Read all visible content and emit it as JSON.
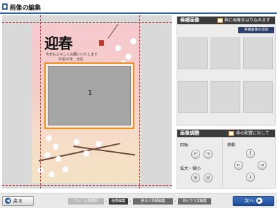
{
  "window": {
    "title": "画像の編集"
  },
  "card": {
    "logo_text": "迎春",
    "greeting_line1": "今年もよろしくお願いいたします",
    "greeting_line2": "平成28年　元旦",
    "photo_slot_number": "1"
  },
  "candidates": {
    "title": "候補画像",
    "checkbox_label": "枠に画像をはり込みます",
    "add_button": "候補画像の追加"
  },
  "adjust": {
    "title": "画像調整",
    "checkbox_label": "枠の配置に対して",
    "rotate_label": "回転",
    "zoom_label": "拡大・縮小",
    "move_label": "移動"
  },
  "footer": {
    "back_label": "戻る",
    "next_label": "次へ",
    "steps": [
      "フレーム再選択",
      "画像編集",
      "差出人情報編集",
      "あいさつ文編集"
    ]
  },
  "colors": {
    "accent_blue": "#2f5fa6",
    "frame_orange": "#f28c1a",
    "panel_header": "#3b3b3b"
  }
}
